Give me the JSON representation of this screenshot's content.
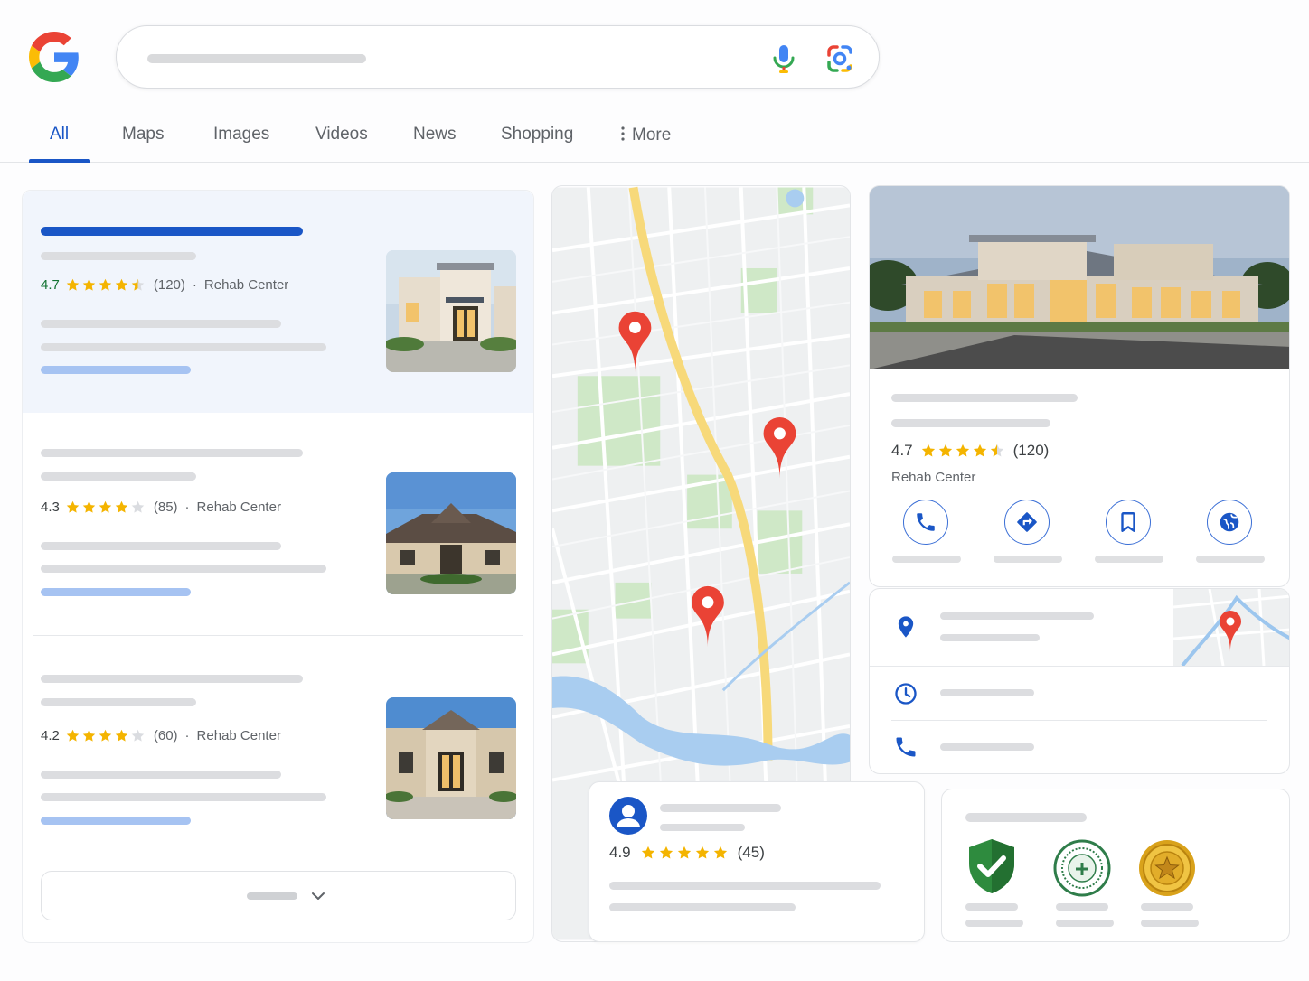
{
  "header": {
    "logo_icon": "google-g-icon",
    "search": {
      "value": "",
      "mic_icon": "microphone-icon",
      "lens_icon": "google-lens-icon"
    }
  },
  "tabs": [
    {
      "label": "All",
      "active": true
    },
    {
      "label": "Maps"
    },
    {
      "label": "Images"
    },
    {
      "label": "Videos"
    },
    {
      "label": "News"
    },
    {
      "label": "Shopping"
    },
    {
      "label": "More",
      "icon": "vertical-dots-icon"
    }
  ],
  "results": [
    {
      "rating": "4.7",
      "stars": 4.5,
      "reviews": "(120)",
      "category": "Rehab Center",
      "separator": "·"
    },
    {
      "rating": "4.3",
      "stars": 4,
      "reviews": "(85)",
      "category": "Rehab Center",
      "separator": "·"
    },
    {
      "rating": "4.2",
      "stars": 4,
      "reviews": "(60)",
      "category": "Rehab Center",
      "separator": "·"
    }
  ],
  "more_results": {
    "icon": "chevron-down-icon"
  },
  "map": {
    "pins": 3
  },
  "knowledge_panel": {
    "rating": "4.7",
    "stars": 4.5,
    "reviews": "(120)",
    "category": "Rehab Center",
    "actions": [
      {
        "icon": "phone-icon"
      },
      {
        "icon": "directions-icon"
      },
      {
        "icon": "bookmark-icon"
      },
      {
        "icon": "website-globe-icon"
      }
    ],
    "info_rows": [
      {
        "icon": "location-pin-icon"
      },
      {
        "icon": "clock-icon"
      },
      {
        "icon": "phone-icon"
      }
    ]
  },
  "review": {
    "rating": "4.9",
    "stars": 5,
    "reviews": "(45)",
    "avatar_icon": "user-avatar-icon"
  },
  "badges": [
    {
      "icon": "shield-check-icon"
    },
    {
      "icon": "health-certification-seal-icon"
    },
    {
      "icon": "gold-star-seal-icon"
    }
  ],
  "colors": {
    "accent": "#1a56c6",
    "star": "#f4b400",
    "pin": "#ea4335",
    "rating_green": "#137333"
  }
}
